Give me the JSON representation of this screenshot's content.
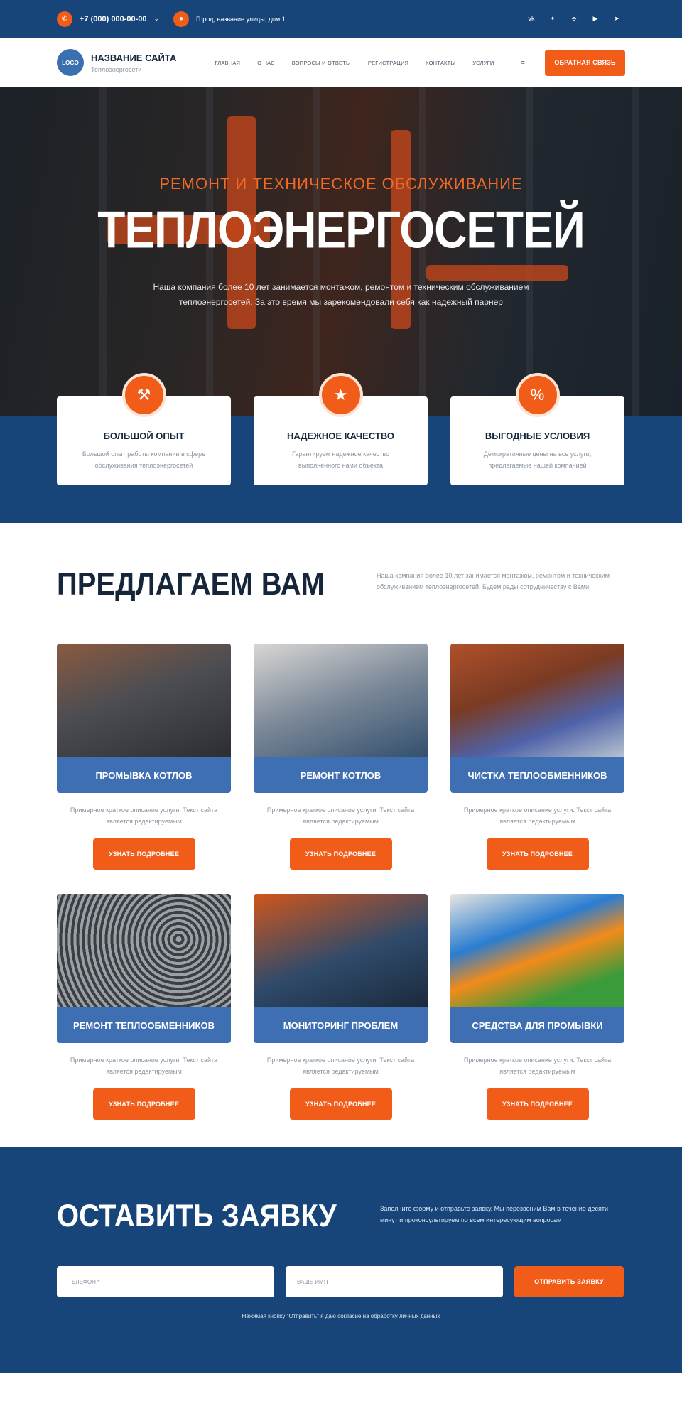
{
  "topbar": {
    "phone": "+7 (000) 000-00-00",
    "address": "Город, название улицы, дом 1",
    "socials": [
      "vk",
      "twitter",
      "ok",
      "youtube",
      "telegram"
    ]
  },
  "header": {
    "logo": "LOGO",
    "site_name": "НАЗВАНИЕ САЙТА",
    "site_sub": "Теплоэнергосети",
    "nav": [
      "ГЛАВНАЯ",
      "О НАС",
      "ВОПРОСЫ И ОТВЕТЫ",
      "РЕГИСТРАЦИЯ",
      "КОНТАКТЫ",
      "УСЛУГИ"
    ],
    "cta": "ОБРАТНАЯ СВЯЗЬ"
  },
  "hero": {
    "sup": "РЕМОНТ И ТЕХНИЧЕСКОЕ ОБСЛУЖИВАНИЕ",
    "title": "ТЕПЛОЭНЕРГОСЕТЕЙ",
    "desc": "Наша компания более 10 лет занимается монтажом, ремонтом и техническим обслуживанием теплоэнергосетей. За это время мы зарекомендовали себя как надежный парнер"
  },
  "features": [
    {
      "icon": "tools-icon",
      "title": "БОЛЬШОЙ ОПЫТ",
      "text": "Большой опыт работы компании в сфере обслуживания теплоэнергосетей"
    },
    {
      "icon": "award-icon",
      "title": "НАДЕЖНОЕ КАЧЕСТВО",
      "text": "Гарантируем надежное качество выполненного нами объекта"
    },
    {
      "icon": "discount-icon",
      "title": "ВЫГОДНЫЕ УСЛОВИЯ",
      "text": "Демократичные цены на все услуги, предлагаемые нашей компанией"
    }
  ],
  "offer": {
    "title": "ПРЕДЛАГАЕМ ВАМ",
    "desc": "Наша компания более 10 лет занимается монтажом, ремонтом и техническим обслуживанием теплоэнергосетей. Будем рады сотрудничеству с Вами!",
    "card_text": "Примерное краткое описание услуги. Текст сайта является редактируемым",
    "button": "УЗНАТЬ ПОДРОБНЕЕ",
    "cards": [
      "ПРОМЫВКА КОТЛОВ",
      "РЕМОНТ КОТЛОВ",
      "ЧИСТКА ТЕПЛООБМЕННИКОВ",
      "РЕМОНТ ТЕПЛООБМЕННИКОВ",
      "МОНИТОРИНГ ПРОБЛЕМ",
      "СРЕДСТВА ДЛЯ ПРОМЫВКИ"
    ]
  },
  "request": {
    "title": "ОСТАВИТЬ ЗАЯВКУ",
    "desc": "Заполните форму и отправьте заявку. Мы перезвоним Вам в течение десяти минут и проконсультируем по всем интересующим вопросам",
    "phone_placeholder": "ТЕЛЕФОН *",
    "name_placeholder": "ВАШЕ ИМЯ",
    "submit": "ОТПРАВИТЬ ЗАЯВКУ",
    "consent": "Нажимая кнопку \"Отправить\" я даю согласие на обработку личных данных"
  },
  "colors": {
    "brand_blue": "#17457a",
    "accent_orange": "#f25c19",
    "card_blue": "#3f6fb3"
  }
}
